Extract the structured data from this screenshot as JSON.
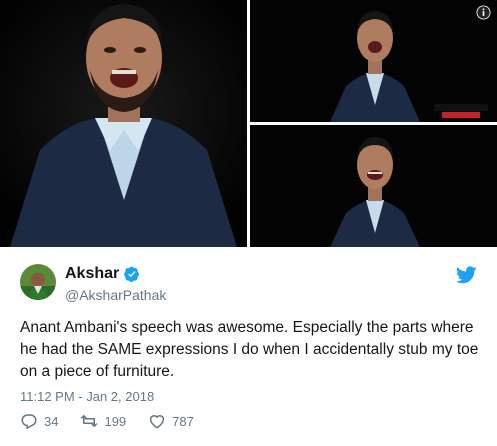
{
  "tweet": {
    "display_name": "Akshar",
    "handle": "@AksharPathak",
    "text": "Anant Ambani's speech was awesome. Especially the parts where he had the SAME expressions I do when I accidentally stub my toe on a piece of furniture.",
    "timestamp": "11:12 PM - Jan 2, 2018",
    "replies": "34",
    "retweets": "199",
    "likes": "787"
  },
  "colors": {
    "twitter_blue": "#1da1f2",
    "meta_gray": "#657786",
    "text_dark": "#14171a",
    "like_icon": "#657786"
  },
  "icons": {
    "info": "info-icon",
    "verified": "verified-badge-icon",
    "brand": "twitter-bird-icon",
    "reply": "reply-icon",
    "retweet": "retweet-icon",
    "like": "heart-icon"
  }
}
